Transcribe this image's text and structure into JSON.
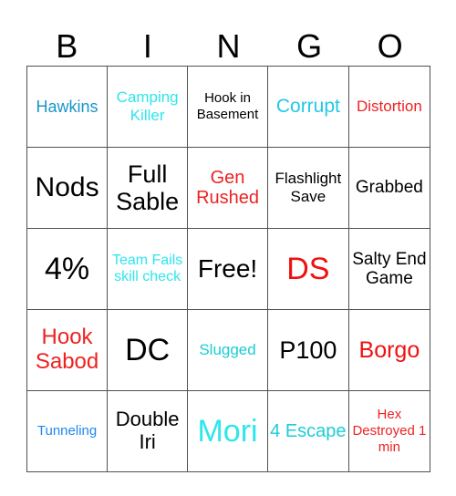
{
  "header": {
    "letters": [
      "B",
      "I",
      "N",
      "G",
      "O"
    ]
  },
  "rows": [
    [
      {
        "text": "Hawkins",
        "color": "#1a95c9",
        "size": 18
      },
      {
        "text": "Camping Killer",
        "color": "#2ee6ec",
        "size": 17
      },
      {
        "text": "Hook in Basement",
        "color": "#000000",
        "size": 15
      },
      {
        "text": "Corrupt",
        "color": "#22c8e8",
        "size": 21
      },
      {
        "text": "Distortion",
        "color": "#ee2222",
        "size": 17
      }
    ],
    [
      {
        "text": "Nods",
        "color": "#000000",
        "size": 30
      },
      {
        "text": "Full Sable",
        "color": "#000000",
        "size": 27
      },
      {
        "text": "Gen Rushed",
        "color": "#ee2222",
        "size": 20
      },
      {
        "text": "Flashlight Save",
        "color": "#000000",
        "size": 17
      },
      {
        "text": "Grabbed",
        "color": "#000000",
        "size": 19
      }
    ],
    [
      {
        "text": "4%",
        "color": "#000000",
        "size": 34
      },
      {
        "text": "Team Fails skill check",
        "color": "#2ee6ec",
        "size": 16
      },
      {
        "text": "Free!",
        "color": "#000000",
        "size": 28
      },
      {
        "text": "DS",
        "color": "#ee1111",
        "size": 34
      },
      {
        "text": "Salty End Game",
        "color": "#000000",
        "size": 19
      }
    ],
    [
      {
        "text": "Hook Sabod",
        "color": "#ee2222",
        "size": 24
      },
      {
        "text": "DC",
        "color": "#000000",
        "size": 34
      },
      {
        "text": "Slugged",
        "color": "#1ccdd6",
        "size": 17
      },
      {
        "text": "P100",
        "color": "#000000",
        "size": 27
      },
      {
        "text": "Borgo",
        "color": "#ee1111",
        "size": 25
      }
    ],
    [
      {
        "text": "Tunneling",
        "color": "#1e88f0",
        "size": 15
      },
      {
        "text": "Double Iri",
        "color": "#000000",
        "size": 22
      },
      {
        "text": "Mori",
        "color": "#2ee6ec",
        "size": 34
      },
      {
        "text": "4 Escape",
        "color": "#1ccdd6",
        "size": 20
      },
      {
        "text": "Hex Destroyed 1 min",
        "color": "#ee2222",
        "size": 15
      }
    ]
  ]
}
